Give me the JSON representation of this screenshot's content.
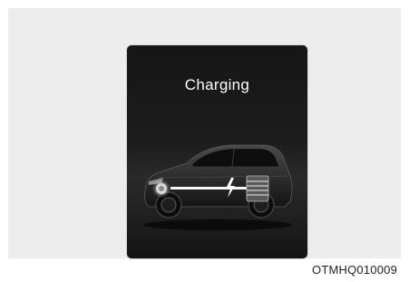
{
  "screen": {
    "title": "Charging",
    "status": "charging",
    "icons": [
      "car-illustration-icon",
      "battery-pack-icon",
      "charging-bolt-icon",
      "motor-icon"
    ]
  },
  "caption": {
    "code": "OTMHQ010009"
  },
  "colors": {
    "panel_background": "#ececec",
    "display_background": "#1a1a1a",
    "text": "#ffffff"
  }
}
